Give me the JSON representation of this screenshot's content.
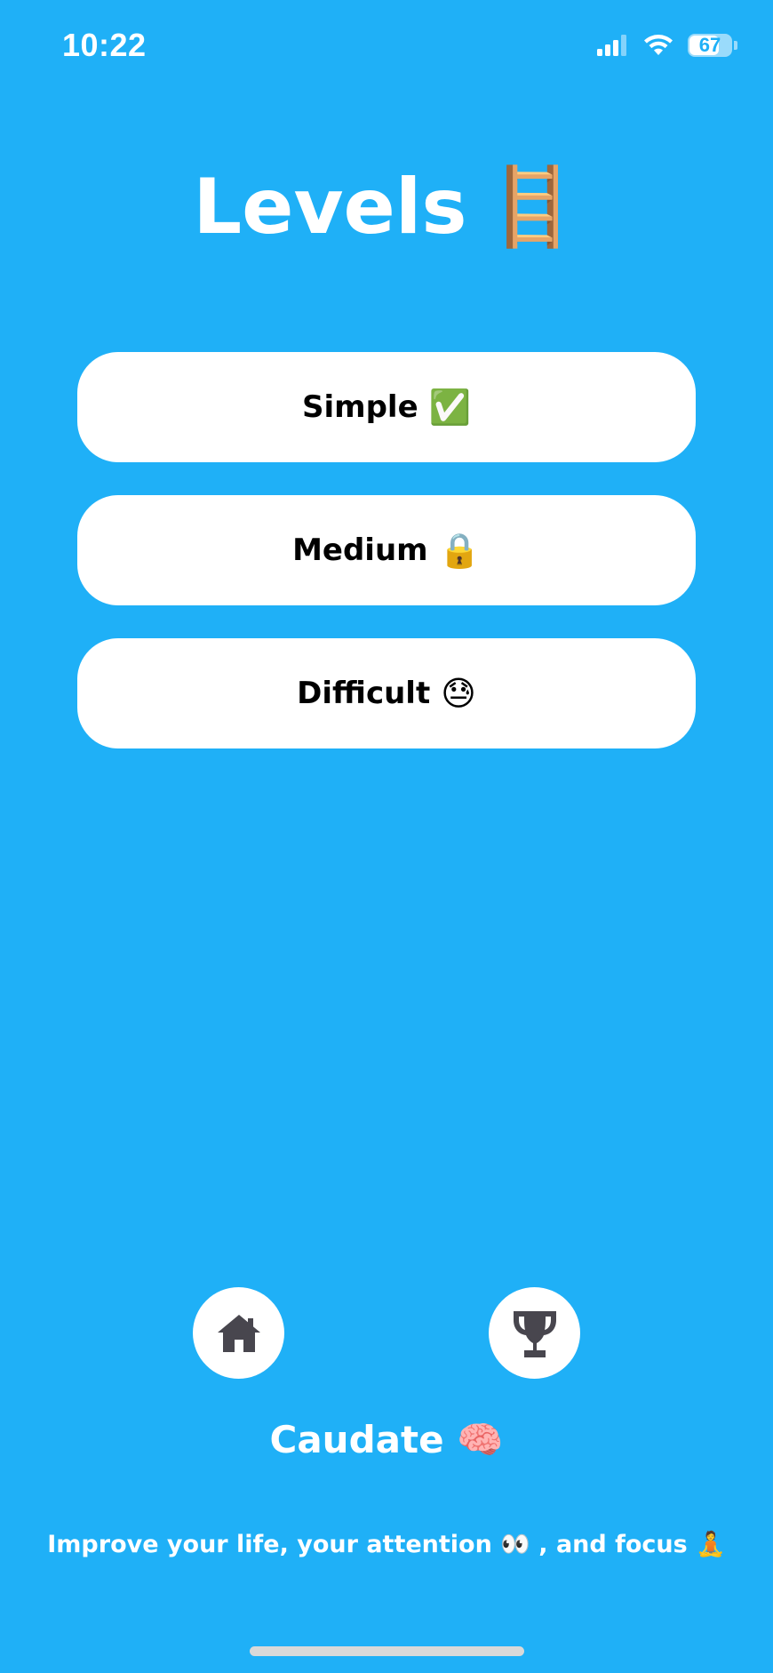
{
  "status_bar": {
    "time": "10:22",
    "battery": "67",
    "signal_icon": "cellular-signal-icon",
    "wifi_icon": "wifi-icon"
  },
  "header": {
    "title": "Levels",
    "title_emoji": "🪜"
  },
  "levels": [
    {
      "label": "Simple",
      "emoji": "✅"
    },
    {
      "label": "Medium",
      "emoji": "🔒"
    },
    {
      "label": "Difficult",
      "emoji": "😓"
    }
  ],
  "nav": {
    "home_icon": "home-icon",
    "trophy_icon": "trophy-icon"
  },
  "footer": {
    "app_name": "Caudate",
    "app_emoji": "🧠",
    "tagline_part1": "Improve your life, your attention",
    "tagline_emoji1": "👀",
    "tagline_part2": ", and focus",
    "tagline_emoji2": "🧘"
  },
  "colors": {
    "background": "#1fb0f7",
    "button_bg": "#ffffff",
    "icon": "#48464e"
  }
}
